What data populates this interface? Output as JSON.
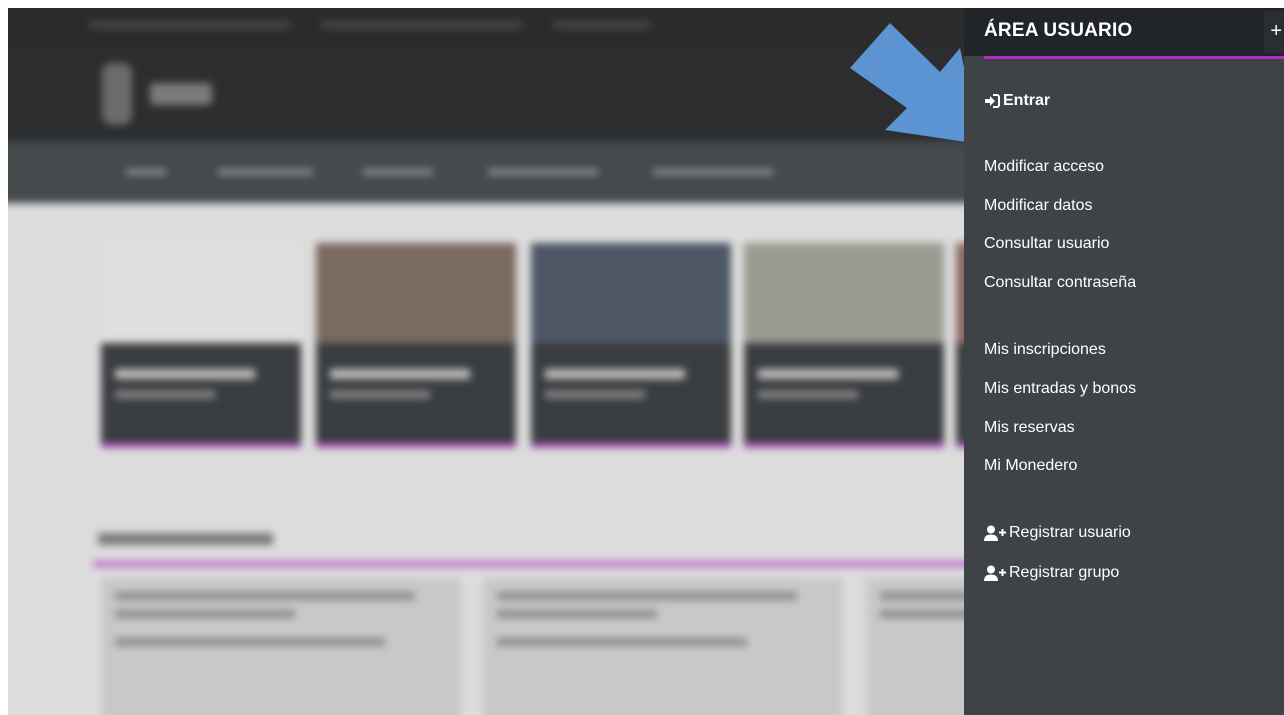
{
  "panel": {
    "title": "ÁREA USUARIO",
    "close_label": "+",
    "login": {
      "label": "Entrar",
      "icon": "sign-in-icon"
    },
    "account_items": [
      {
        "label": "Modificar acceso"
      },
      {
        "label": "Modificar datos"
      },
      {
        "label": "Consultar usuario"
      },
      {
        "label": "Consultar contraseña"
      }
    ],
    "activity_items": [
      {
        "label": "Mis inscripciones"
      },
      {
        "label": "Mis entradas y bonos"
      },
      {
        "label": "Mis reservas"
      },
      {
        "label": "Mi Monedero"
      }
    ],
    "register_items": [
      {
        "label": "Registrar usuario",
        "icon": "user-plus-icon"
      },
      {
        "label": "Registrar grupo",
        "icon": "user-plus-icon"
      }
    ]
  },
  "colors": {
    "panel_bg": "#3f4346",
    "header_bg": "#212428",
    "accent": "#b52bc1",
    "arrow": "#5b93d3"
  }
}
